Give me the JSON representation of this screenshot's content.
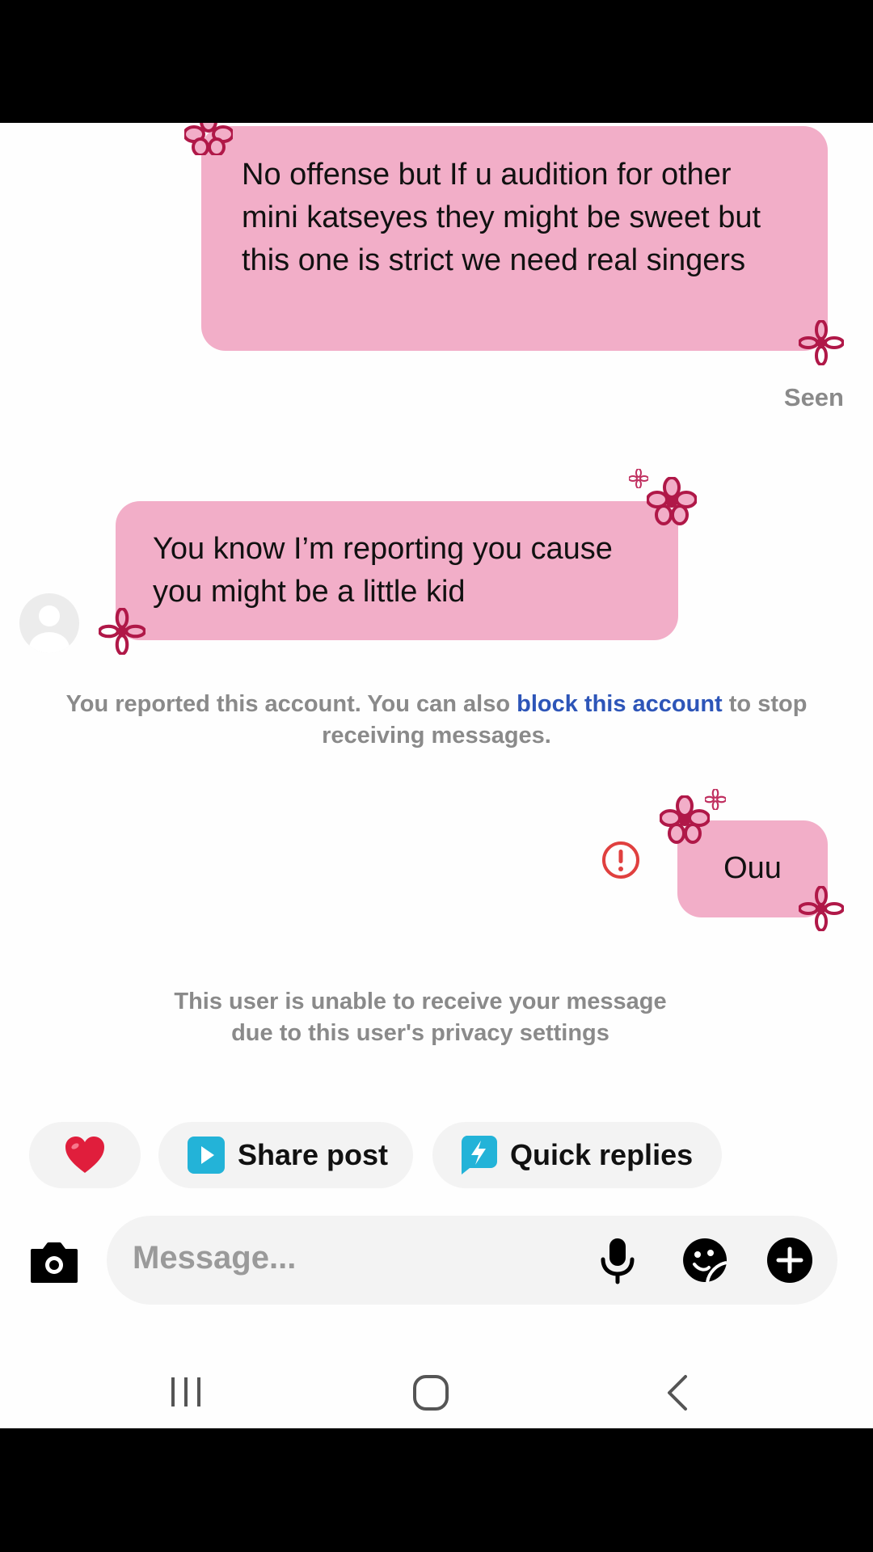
{
  "messages": [
    {
      "direction": "outgoing",
      "text": "No offense but If u audition for other mini katseyes they might be sweet but this one is strict we need real singers"
    },
    {
      "direction": "incoming",
      "text": "You know I’m reporting you cause you might be a little kid"
    },
    {
      "direction": "outgoing",
      "text": "Ouu"
    }
  ],
  "seen_label": "Seen",
  "report_notice": {
    "before": "You reported this account. You can also ",
    "link": "block this account",
    "after": " to stop receiving messages."
  },
  "privacy_notice": {
    "line1": "This user is unable to receive your message",
    "line2": "due to this user's privacy settings"
  },
  "quick_actions": {
    "heart_icon": "red-heart-icon",
    "share_post": "Share post",
    "quick_replies": "Quick replies"
  },
  "composer": {
    "placeholder": "Message..."
  },
  "colors": {
    "bubble": "#f2aec8",
    "link": "#2d55b8",
    "error": "#e0403f",
    "share_icon": "#23b3d8"
  }
}
